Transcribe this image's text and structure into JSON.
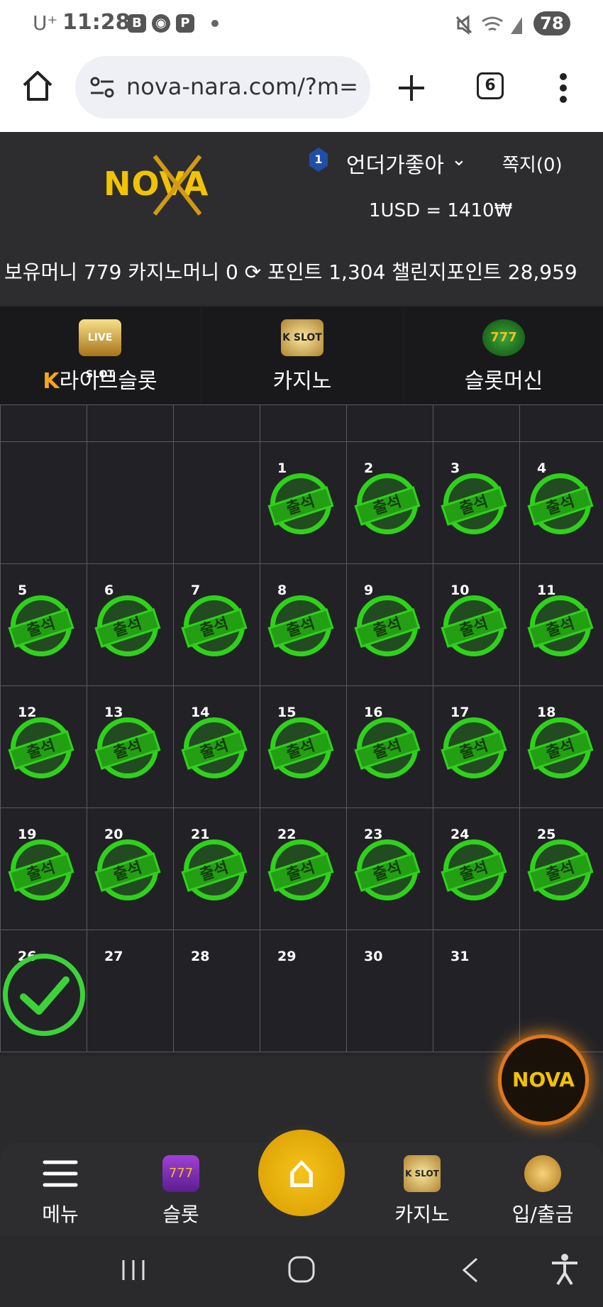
{
  "status_bar": {
    "carrier": "U⁺",
    "time": "11:28",
    "icons": [
      "B",
      "◉",
      "P"
    ],
    "battery": "78"
  },
  "browser": {
    "url": "nova-nara.com/?m=",
    "tab_count": "6"
  },
  "header": {
    "logo": "NOVA",
    "level": "1",
    "username": "언더가좋아",
    "messages": "쪽지(0)",
    "rate": "1USD = 1410₩",
    "balances": "보유머니 779 카지노머니 0 ⟳ 포인트 1,304 챌린지포인트 28,959"
  },
  "game_tabs": [
    {
      "label": "라이브슬롯",
      "icon": "LIVE SLOT",
      "prefix": "K"
    },
    {
      "label": "카지노",
      "icon": "K SLOT"
    },
    {
      "label": "슬롯머신",
      "icon": "777"
    }
  ],
  "calendar": {
    "stamp_text": "출석",
    "days": [
      "",
      "",
      "",
      "1",
      "2",
      "3",
      "4",
      "5",
      "6",
      "7",
      "8",
      "9",
      "10",
      "11",
      "12",
      "13",
      "14",
      "15",
      "16",
      "17",
      "18",
      "19",
      "20",
      "21",
      "22",
      "23",
      "24",
      "25",
      "26",
      "27",
      "28",
      "29",
      "30",
      "31",
      ""
    ],
    "stamped_through": 25,
    "today": "26"
  },
  "floating_logo": "NOVA",
  "bottom_nav": {
    "menu": "메뉴",
    "slot": "슬롯",
    "casino": "카지노",
    "cash": "입/출금"
  }
}
